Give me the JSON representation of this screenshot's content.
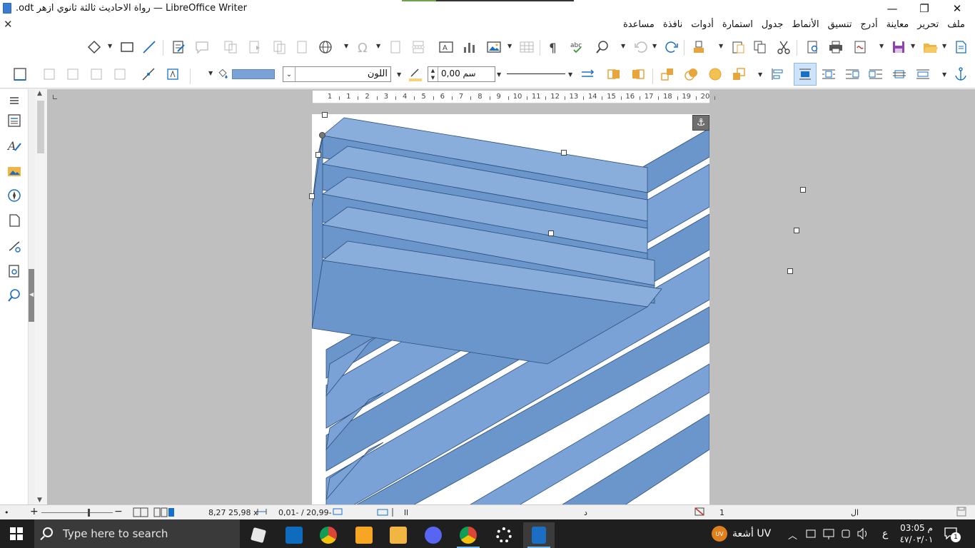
{
  "window": {
    "title": ".odt رواة الاحاديث ثالثة ثانوي ازهر — LibreOffice Writer",
    "minimize": "—",
    "restore": "❐",
    "close": "✕"
  },
  "menu": {
    "close_doc": "✕",
    "items": [
      "ملف",
      "تحرير",
      "معاينة",
      "أدرج",
      "تنسيق",
      "الأنماط",
      "جدول",
      "استمارة",
      "أدوات",
      "نافذة",
      "مساعدة"
    ]
  },
  "toolbar2": {
    "area_color_name": "اللون",
    "line_width": "0,00 سم"
  },
  "ruler": {
    "numbers": [
      "1",
      "1",
      "2",
      "3",
      "4",
      "5",
      "6",
      "7",
      "8",
      "9",
      "10",
      "11",
      "12",
      "13",
      "14",
      "15",
      "16",
      "17",
      "18",
      "19",
      "20"
    ]
  },
  "statusbar": {
    "zoom_plus": "+",
    "zoom_minus": "−",
    "position": "8,27 25,98 x",
    "size": "0,01- / 20,99-",
    "page_field": "1",
    "lang_marker": "د",
    "word_marker": "ال",
    "dot": "•"
  },
  "taskbar": {
    "search_placeholder": "Type here to search",
    "weather": "أشعة UV",
    "uv_badge": "UV",
    "lang": "ع",
    "time": "03:05 م",
    "date": "٤٧/٠٣/٠١",
    "notification_count": "1"
  },
  "colors": {
    "shape_fill": "#7ba2d6",
    "shape_dark": "#6b96cc",
    "shape_stroke": "#2d4f7a",
    "accent": "#1a6fc4"
  }
}
